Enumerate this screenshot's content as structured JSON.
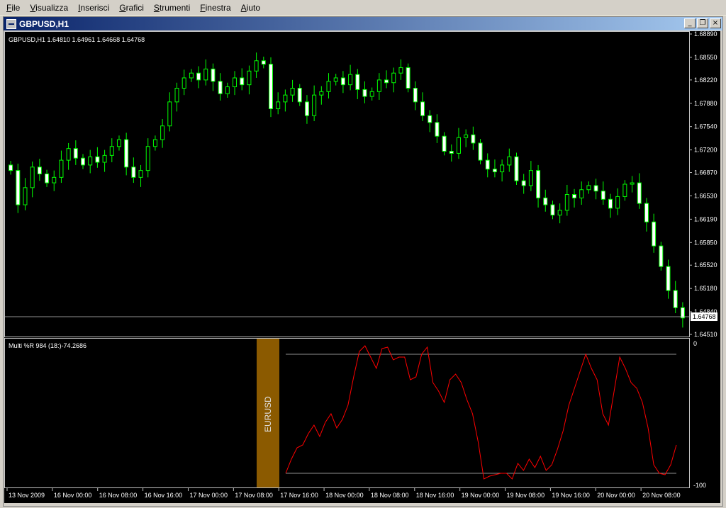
{
  "menu": [
    {
      "label": "File",
      "ul": "F",
      "rest": "ile"
    },
    {
      "label": "Visualizza",
      "ul": "V",
      "rest": "isualizza"
    },
    {
      "label": "Inserisci",
      "ul": "I",
      "rest": "nserisci"
    },
    {
      "label": "Grafici",
      "ul": "G",
      "rest": "rafici"
    },
    {
      "label": "Strumenti",
      "ul": "S",
      "rest": "trumenti"
    },
    {
      "label": "Finestra",
      "ul": "F",
      "rest": "inestra"
    },
    {
      "label": "Aiuto",
      "ul": "A",
      "rest": "iuto"
    }
  ],
  "window": {
    "title": "GBPUSD,H1",
    "minimize_icon": "minimize-icon",
    "restore_icon": "restore-icon",
    "close_icon": "close-icon"
  },
  "chart_data": {
    "type": "candlestick",
    "symbol": "GBPUSD,H1",
    "info_line": "GBPUSD,H1  1.64810 1.64961 1.64668 1.64768",
    "ylim": [
      1.6451,
      1.6889
    ],
    "price_ticks": [
      "1.68890",
      "1.68550",
      "1.68220",
      "1.67880",
      "1.67540",
      "1.67200",
      "1.66870",
      "1.66530",
      "1.66190",
      "1.65850",
      "1.65520",
      "1.65180",
      "1.64840",
      "1.64510"
    ],
    "current_price": "1.64768",
    "time_ticks": [
      "13 Nov 2009",
      "16 Nov 00:00",
      "16 Nov 08:00",
      "16 Nov 16:00",
      "17 Nov 00:00",
      "17 Nov 08:00",
      "17 Nov 16:00",
      "18 Nov 00:00",
      "18 Nov 08:00",
      "18 Nov 16:00",
      "19 Nov 00:00",
      "19 Nov 08:00",
      "19 Nov 16:00",
      "20 Nov 00:00",
      "20 Nov 08:00"
    ],
    "closes": [
      1.669,
      1.664,
      1.6665,
      1.6695,
      1.6685,
      1.6672,
      1.668,
      1.6705,
      1.6722,
      1.6708,
      1.6698,
      1.671,
      1.6702,
      1.6712,
      1.6725,
      1.6735,
      1.6695,
      1.668,
      1.669,
      1.6725,
      1.6735,
      1.6755,
      1.679,
      1.681,
      1.6825,
      1.6832,
      1.6822,
      1.6838,
      1.682,
      1.6802,
      1.6812,
      1.6825,
      1.6815,
      1.6835,
      1.685,
      1.6845,
      1.678,
      1.679,
      1.68,
      1.681,
      1.679,
      1.677,
      1.68,
      1.6805,
      1.682,
      1.6825,
      1.6815,
      1.683,
      1.6808,
      1.6798,
      1.6805,
      1.6822,
      1.6818,
      1.6832,
      1.684,
      1.681,
      1.679,
      1.677,
      1.676,
      1.674,
      1.6718,
      1.6715,
      1.6738,
      1.6742,
      1.673,
      1.6705,
      1.6692,
      1.6688,
      1.6698,
      1.671,
      1.6675,
      1.6668,
      1.669,
      1.665,
      1.664,
      1.6625,
      1.6632,
      1.6655,
      1.665,
      1.6662,
      1.6668,
      1.666,
      1.6648,
      1.6635,
      1.6652,
      1.667,
      1.6672,
      1.6642,
      1.6615,
      1.658,
      1.655,
      1.6515,
      1.649,
      1.6475
    ],
    "indicator": {
      "label": "Multi %R 984 (18:)-74.2686",
      "symbol_tag": "EURUSD",
      "ylim": [
        -100,
        0
      ],
      "y_ticks": [
        "0",
        "-100"
      ],
      "levels": [
        -8,
        -92
      ],
      "values": [
        -92,
        -82,
        -74,
        -72,
        -64,
        -58,
        -66,
        -56,
        -50,
        -60,
        -54,
        -44,
        -24,
        -6,
        -2,
        -10,
        -18,
        -4,
        -3,
        -12,
        -10,
        -10,
        -26,
        -24,
        -8,
        -3,
        -28,
        -34,
        -42,
        -26,
        -22,
        -28,
        -40,
        -50,
        -70,
        -96,
        -94,
        -93,
        -92,
        -92,
        -96,
        -85,
        -90,
        -82,
        -88,
        -80,
        -90,
        -86,
        -75,
        -62,
        -44,
        -32,
        -20,
        -8,
        -18,
        -26,
        -50,
        -58,
        -34,
        -10,
        -18,
        -28,
        -32,
        -42,
        -60,
        -86,
        -92,
        -93,
        -86,
        -72
      ]
    }
  }
}
